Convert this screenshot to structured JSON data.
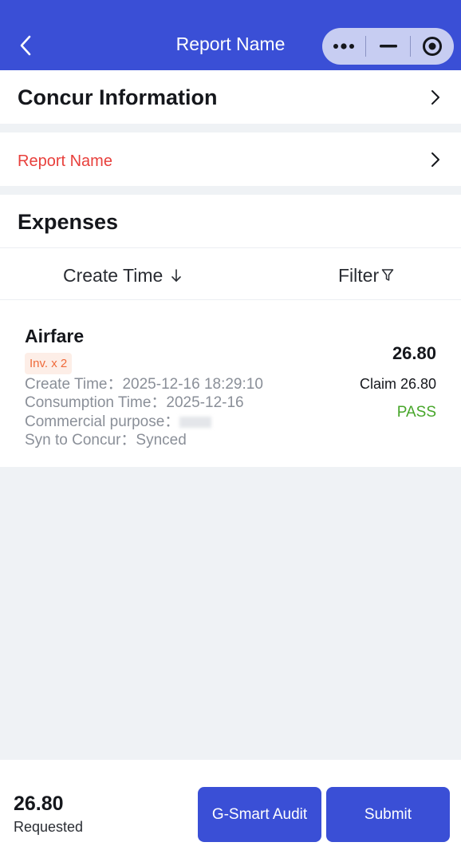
{
  "header": {
    "title": "Report Name"
  },
  "concur": {
    "title": "Concur Information"
  },
  "report": {
    "label": "Report Name"
  },
  "expenses": {
    "title": "Expenses",
    "sort_label": "Create Time",
    "filter_label": "Filter",
    "items": [
      {
        "name": "Airfare",
        "badge": "Inv. x 2",
        "create_time": "Create Time：2025-12-16 18:29:10",
        "consumption_time": "Consumption Time：2025-12-16",
        "commercial_purpose": "Commercial purpose：",
        "sync": "Syn to Concur：Synced",
        "amount": "26.80",
        "claim": "Claim 26.80",
        "status": "PASS"
      }
    ]
  },
  "footer": {
    "total": "26.80",
    "total_label": "Requested",
    "audit_button": "G-Smart Audit",
    "submit_button": "Submit"
  },
  "colors": {
    "primary": "#3a4fd6",
    "pass": "#47a62a",
    "badge_text": "#ef6a3a",
    "report_label": "#e8403c"
  }
}
